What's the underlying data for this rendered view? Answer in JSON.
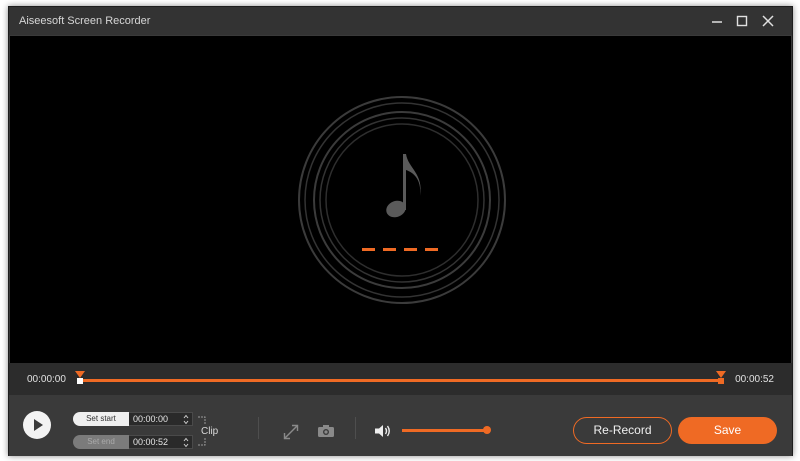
{
  "window": {
    "title": "Aiseesoft Screen Recorder"
  },
  "player": {
    "media_type_icon": "music-note-icon",
    "current_time": "00:00:00",
    "total_time": "00:00:52",
    "trim_start_fraction": 0.0,
    "trim_end_fraction": 1.0
  },
  "clip": {
    "set_start_label": "Set start",
    "set_end_label": "Set end",
    "start_value": "00:00:00",
    "end_value": "00:00:52",
    "clip_label": "Clip"
  },
  "audio": {
    "volume_fraction": 1.0
  },
  "buttons": {
    "rerecord_label": "Re-Record",
    "save_label": "Save"
  },
  "colors": {
    "accent": "#ef6a24",
    "background": "#3a3a3a",
    "video_background": "#000000"
  }
}
